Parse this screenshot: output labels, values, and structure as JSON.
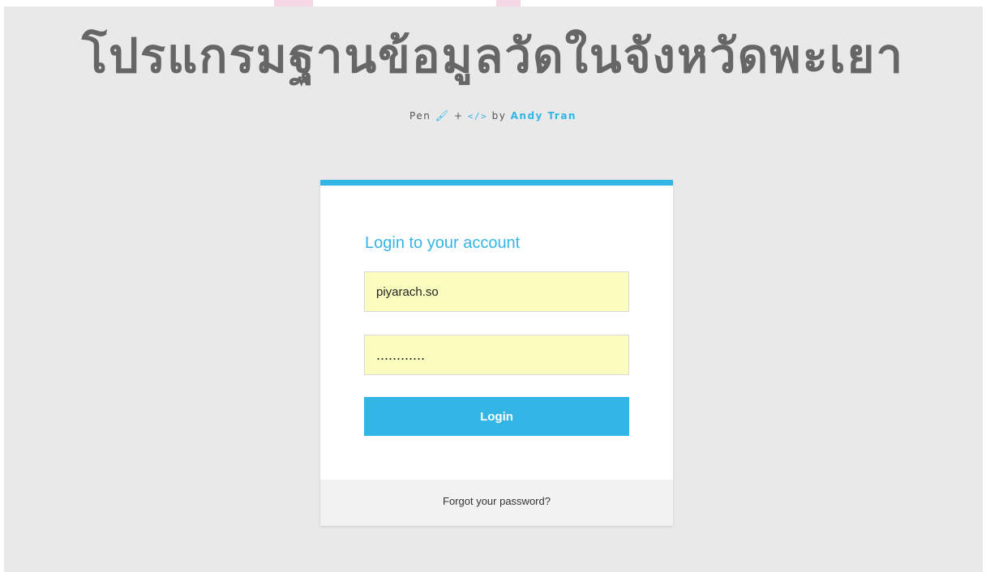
{
  "header": {
    "title": "โปรแกรมฐานข้อมูลวัดในจังหวัดพะเยา",
    "credit": {
      "prefix": "Pen",
      "plus": "+",
      "by": "by",
      "author": "Andy Tran",
      "brush_icon": "brush-icon",
      "code_icon": "code-icon"
    }
  },
  "login": {
    "title": "Login to your account",
    "username_value": "piyarach.so",
    "password_value": "............",
    "button_label": "Login",
    "forgot_link": "Forgot your password?"
  },
  "colors": {
    "accent": "#33b5e5",
    "background": "#e9e9e9",
    "input_fill": "#fafdbd",
    "title_text": "#666666"
  }
}
